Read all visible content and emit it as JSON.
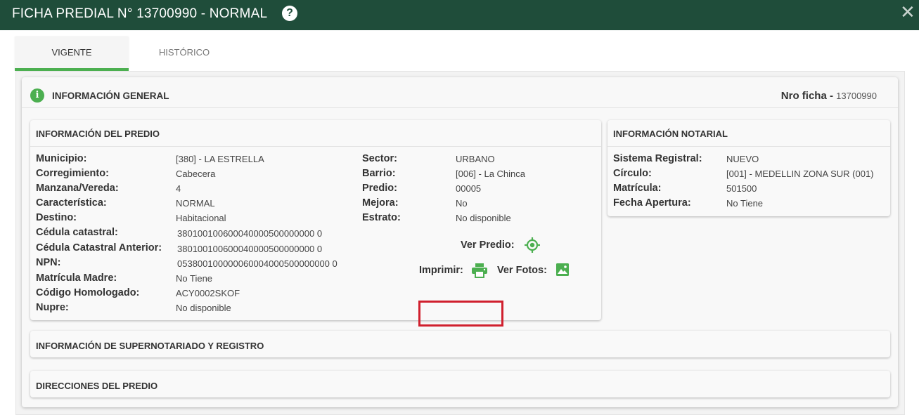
{
  "header": {
    "title": "FICHA PREDIAL N° 13700990 - NORMAL",
    "help_glyph": "?",
    "close_glyph": "✕"
  },
  "tabs": [
    {
      "label": "VIGENTE",
      "active": true
    },
    {
      "label": "HISTÓRICO",
      "active": false
    }
  ],
  "general": {
    "title": "INFORMACIÓN GENERAL",
    "icon_glyph": "i",
    "nro_label": "Nro ficha -",
    "nro_value": "13700990"
  },
  "predio": {
    "title": "INFORMACIÓN DEL PREDIO",
    "left": [
      {
        "label": "Municipio:",
        "value": "[380] - LA ESTRELLA"
      },
      {
        "label": "Corregimiento:",
        "value": "Cabecera"
      },
      {
        "label": "Manzana/Vereda:",
        "value": "4"
      },
      {
        "label": "Característica:",
        "value": "NORMAL"
      },
      {
        "label": "Destino:",
        "value": "Habitacional"
      },
      {
        "label": "Cédula catastral:",
        "value": "380100100600040000500000000 0"
      },
      {
        "label": "Cédula Catastral Anterior:",
        "value": "380100100600040000500000000 0"
      },
      {
        "label": "NPN:",
        "value": "053800100000060004000500000000 0"
      },
      {
        "label": "Matrícula Madre:",
        "value": "No Tiene"
      },
      {
        "label": "Código Homologado:",
        "value": "ACY0002SKOF"
      },
      {
        "label": "Nupre:",
        "value": "No disponible"
      }
    ],
    "right": [
      {
        "label": "Sector:",
        "value": "URBANO"
      },
      {
        "label": "Barrio:",
        "value": "[006] - La Chinca"
      },
      {
        "label": "Predio:",
        "value": "00005"
      },
      {
        "label": "Mejora:",
        "value": "No"
      },
      {
        "label": "Estrato:",
        "value": "No disponible"
      }
    ],
    "actions": {
      "ver_predio": "Ver Predio:",
      "imprimir": "Imprimir:",
      "ver_fotos": "Ver Fotos:"
    }
  },
  "notarial": {
    "title": "INFORMACIÓN NOTARIAL",
    "rows": [
      {
        "label": "Sistema Registral:",
        "value": "NUEVO"
      },
      {
        "label": "Círculo:",
        "value": "[001] - MEDELLIN ZONA SUR (001)"
      },
      {
        "label": "Matrícula:",
        "value": "501500"
      },
      {
        "label": "Fecha Apertura:",
        "value": "No Tiene"
      }
    ]
  },
  "sections": {
    "supernotariado": "INFORMACIÓN DE SUPERNOTARIADO Y REGISTRO",
    "direcciones": "DIRECCIONES DEL PREDIO"
  },
  "colors": {
    "header_bg": "#1f4d3a",
    "accent_green": "#4caf50",
    "highlight_red": "#d0202e"
  }
}
